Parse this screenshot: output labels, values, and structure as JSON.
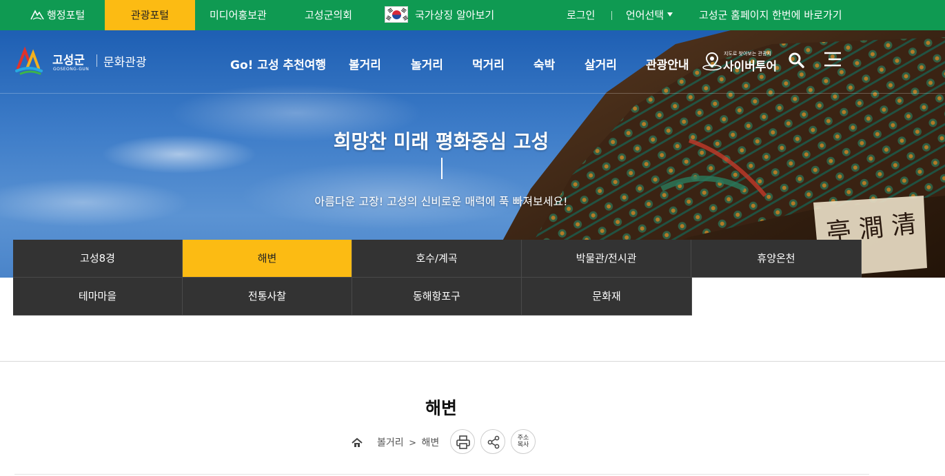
{
  "topbar": {
    "items": [
      {
        "label": "행정포털",
        "icon": "mountain-logo-icon"
      },
      {
        "label": "관광포털"
      },
      {
        "label": "미디어홍보관"
      },
      {
        "label": "고성군의회"
      },
      {
        "label": "국가상징 알아보기",
        "icon": "korean-flag-icon"
      }
    ],
    "login": "로그인",
    "language": "언어선택",
    "shortcut": "고성군 홈페이지 한번에 바로가기",
    "colors": {
      "bar": "#0f9a52",
      "active": "#fcbb13"
    }
  },
  "header": {
    "logo_name": "고성군",
    "logo_sub": "GOSEONG-GUN",
    "category": "문화관광",
    "nav": [
      "Go! 고성 추천여행",
      "볼거리",
      "놀거리",
      "먹거리",
      "숙박",
      "살거리",
      "관광안내"
    ],
    "cyber_small": "지도로 찾아보는 관광지",
    "cyber_big": "사이버투어",
    "icons": [
      "search-icon",
      "hamburger-menu-icon"
    ]
  },
  "hero": {
    "title": "희망찬 미래 평화중심 고성",
    "subtitle": "아름다운 고장! 고성의 신비로운 매력에 푹 빠져보세요!"
  },
  "subnav": {
    "row1": [
      "고성8경",
      "해변",
      "호수/계곡",
      "박물관/전시관",
      "휴양온천"
    ],
    "row2": [
      "테마마을",
      "전통사찰",
      "동해항포구",
      "문화재"
    ],
    "active": "해변"
  },
  "page": {
    "title": "해변",
    "breadcrumb": {
      "section": "볼거리",
      "current": "해변"
    },
    "address_copy": [
      "주소",
      "복사"
    ]
  }
}
